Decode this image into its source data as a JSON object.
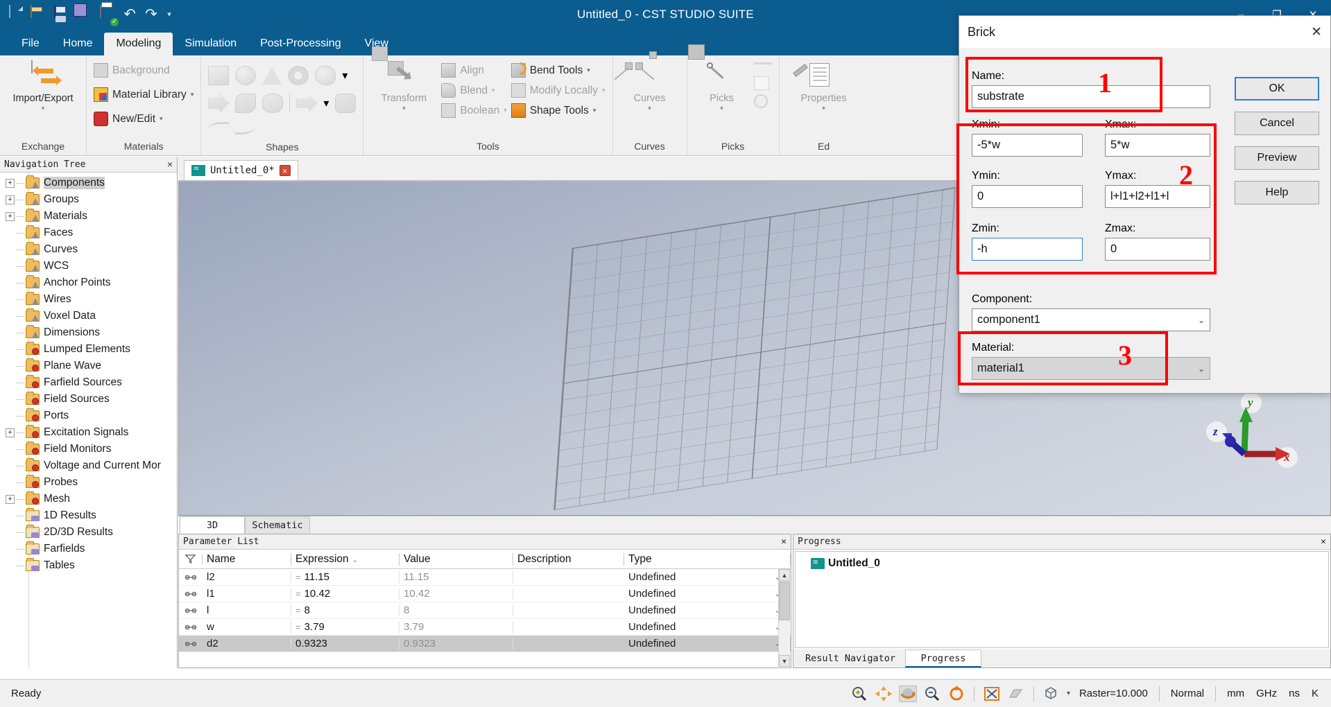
{
  "app": {
    "title": "Untitled_0 - CST STUDIO SUITE",
    "window_buttons": {
      "minimize": "–",
      "maximize": "❐",
      "close": "✕"
    }
  },
  "quick_access": {
    "icons": [
      "new-document-icon",
      "open-folder-icon",
      "save-icon",
      "save-all-icon",
      "print-icon",
      "undo-icon",
      "redo-icon",
      "customize-qat-icon"
    ],
    "undo_glyph": "↶",
    "redo_glyph": "↷",
    "caret_glyph": "≡"
  },
  "ribbon_tabs": [
    {
      "label": "File",
      "active": false
    },
    {
      "label": "Home",
      "active": false
    },
    {
      "label": "Modeling",
      "active": true
    },
    {
      "label": "Simulation",
      "active": false
    },
    {
      "label": "Post-Processing",
      "active": false
    },
    {
      "label": "View",
      "active": false
    }
  ],
  "ribbon": {
    "groups": [
      {
        "name": "Exchange",
        "label": "Exchange",
        "big_button": {
          "label": "Import/Export",
          "arrow": "▾"
        }
      },
      {
        "name": "Materials",
        "label": "Materials",
        "items": [
          {
            "label": "Background",
            "dim": true,
            "dropdown": false
          },
          {
            "label": "Material Library",
            "dim": false,
            "dropdown": true
          },
          {
            "label": "New/Edit",
            "dim": false,
            "dropdown": true
          }
        ]
      },
      {
        "name": "Shapes",
        "label": "Shapes"
      },
      {
        "name": "Tools",
        "label": "Tools",
        "big_button": {
          "label": "Transform",
          "arrow": "▾"
        },
        "items": [
          {
            "label": "Align",
            "dim": true,
            "dropdown": false
          },
          {
            "label": "Blend",
            "dim": true,
            "dropdown": true
          },
          {
            "label": "Boolean",
            "dim": true,
            "dropdown": true
          },
          {
            "label": "Bend Tools",
            "dim": false,
            "dropdown": true
          },
          {
            "label": "Modify Locally",
            "dim": true,
            "dropdown": true
          },
          {
            "label": "Shape Tools",
            "dim": false,
            "dropdown": true
          }
        ]
      },
      {
        "name": "Curves",
        "label": "Curves",
        "big_button": {
          "label": "Curves",
          "arrow": "▾"
        }
      },
      {
        "name": "Picks",
        "label": "Picks",
        "big_button": {
          "label": "Picks",
          "arrow": "▾"
        }
      },
      {
        "name": "Edit",
        "label": "Ed",
        "big_button": {
          "label": "Properties",
          "arrow": "▾"
        }
      }
    ]
  },
  "navigation": {
    "title": "Navigation Tree",
    "close_glyph": "✕",
    "items": [
      {
        "label": "Components",
        "expandable": true,
        "icon": "folder-cone-icon",
        "selected": true
      },
      {
        "label": "Groups",
        "expandable": true,
        "icon": "folder-cone-icon",
        "selected": false
      },
      {
        "label": "Materials",
        "expandable": true,
        "icon": "folder-cone-icon",
        "selected": false
      },
      {
        "label": "Faces",
        "expandable": false,
        "icon": "folder-cone-icon",
        "selected": false
      },
      {
        "label": "Curves",
        "expandable": false,
        "icon": "folder-cone-icon",
        "selected": false
      },
      {
        "label": "WCS",
        "expandable": false,
        "icon": "folder-cone-icon",
        "selected": false
      },
      {
        "label": "Anchor Points",
        "expandable": false,
        "icon": "folder-cone-icon",
        "selected": false
      },
      {
        "label": "Wires",
        "expandable": false,
        "icon": "folder-cone-icon",
        "selected": false
      },
      {
        "label": "Voxel Data",
        "expandable": false,
        "icon": "folder-cone-icon",
        "selected": false
      },
      {
        "label": "Dimensions",
        "expandable": false,
        "icon": "folder-cone-icon",
        "selected": false
      },
      {
        "label": "Lumped Elements",
        "expandable": false,
        "icon": "folder-gear-icon",
        "selected": false
      },
      {
        "label": "Plane Wave",
        "expandable": false,
        "icon": "folder-gear-icon",
        "selected": false
      },
      {
        "label": "Farfield Sources",
        "expandable": false,
        "icon": "folder-gear-icon",
        "selected": false
      },
      {
        "label": "Field Sources",
        "expandable": false,
        "icon": "folder-gear-icon",
        "selected": false
      },
      {
        "label": "Ports",
        "expandable": false,
        "icon": "folder-gear-icon",
        "selected": false
      },
      {
        "label": "Excitation Signals",
        "expandable": true,
        "icon": "folder-gear-icon",
        "selected": false
      },
      {
        "label": "Field Monitors",
        "expandable": false,
        "icon": "folder-gear-icon",
        "selected": false
      },
      {
        "label": "Voltage and Current Mor",
        "expandable": false,
        "icon": "folder-gear-icon",
        "selected": false
      },
      {
        "label": "Probes",
        "expandable": false,
        "icon": "folder-gear-icon",
        "selected": false
      },
      {
        "label": "Mesh",
        "expandable": true,
        "icon": "folder-gear-icon",
        "selected": false
      },
      {
        "label": "1D Results",
        "expandable": false,
        "icon": "folder-wave-icon",
        "selected": false
      },
      {
        "label": "2D/3D Results",
        "expandable": false,
        "icon": "folder-wave-icon",
        "selected": false
      },
      {
        "label": "Farfields",
        "expandable": false,
        "icon": "folder-wave-icon",
        "selected": false
      },
      {
        "label": "Tables",
        "expandable": false,
        "icon": "folder-wave-icon",
        "selected": false
      }
    ]
  },
  "document_tab": {
    "label": "Untitled_0*",
    "close_glyph": "✕"
  },
  "view_tabs": [
    {
      "label": "3D",
      "active": true
    },
    {
      "label": "Schematic",
      "active": false
    }
  ],
  "viewport": {
    "axes": {
      "x": "x",
      "y": "y",
      "z": "z"
    }
  },
  "parameter_list": {
    "title": "Parameter List",
    "close_glyph": "✕",
    "columns": [
      "Name",
      "Expression",
      "Value",
      "Description",
      "Type"
    ],
    "sort_marker": "⌄",
    "rows": [
      {
        "name": "l2",
        "expression": "11.15",
        "value": "11.15",
        "description": "",
        "type": "Undefined",
        "selected": false,
        "has_eq": true
      },
      {
        "name": "l1",
        "expression": "10.42",
        "value": "10.42",
        "description": "",
        "type": "Undefined",
        "selected": false,
        "has_eq": true
      },
      {
        "name": "l",
        "expression": "8",
        "value": "8",
        "description": "",
        "type": "Undefined",
        "selected": false,
        "has_eq": true
      },
      {
        "name": "w",
        "expression": "3.79",
        "value": "3.79",
        "description": "",
        "type": "Undefined",
        "selected": false,
        "has_eq": true
      },
      {
        "name": "d2",
        "expression": "0.9323",
        "value": "0.9323",
        "description": "",
        "type": "Undefined",
        "selected": true,
        "has_eq": false
      }
    ]
  },
  "progress_panel": {
    "title": "Progress",
    "close_glyph": "✕",
    "item": "Untitled_0",
    "tabs": [
      {
        "label": "Result Navigator",
        "active": false
      },
      {
        "label": "Progress",
        "active": true
      }
    ]
  },
  "status_bar": {
    "message": "Ready",
    "raster": "Raster=10.000",
    "mode": "Normal",
    "units": [
      "mm",
      "GHz",
      "ns",
      "K"
    ],
    "icons": [
      "zoom-in-icon",
      "pan-icon",
      "rotate-icon",
      "zoom-out-icon",
      "rotate-view-icon",
      "fit-view-icon",
      "perspective-icon",
      "cube-view-icon"
    ]
  },
  "dialog": {
    "title": "Brick",
    "close_glyph": "✕",
    "fields": {
      "name_label": "Name:",
      "name_value": "substrate",
      "xmin_label": "Xmin:",
      "xmin_value": "-5*w",
      "xmax_label": "Xmax:",
      "xmax_value": "5*w",
      "ymin_label": "Ymin:",
      "ymin_value": "0",
      "ymax_label": "Ymax:",
      "ymax_value": "l+l1+l2+l1+l",
      "zmin_label": "Zmin:",
      "zmin_value": "-h",
      "zmax_label": "Zmax:",
      "zmax_value": "0",
      "component_label": "Component:",
      "component_value": "component1",
      "material_label": "Material:",
      "material_value": "material1",
      "dropdown_glyph": "⌄"
    },
    "buttons": [
      {
        "label": "OK",
        "default": true
      },
      {
        "label": "Cancel",
        "default": false
      },
      {
        "label": "Preview",
        "default": false
      },
      {
        "label": "Help",
        "default": false
      }
    ],
    "annotations": [
      {
        "number": "1",
        "target": "name-field"
      },
      {
        "number": "2",
        "target": "coordinates-group"
      },
      {
        "number": "3",
        "target": "material-field"
      }
    ],
    "accent_color": "#ff0000",
    "focus_color": "#2b7fd4"
  }
}
